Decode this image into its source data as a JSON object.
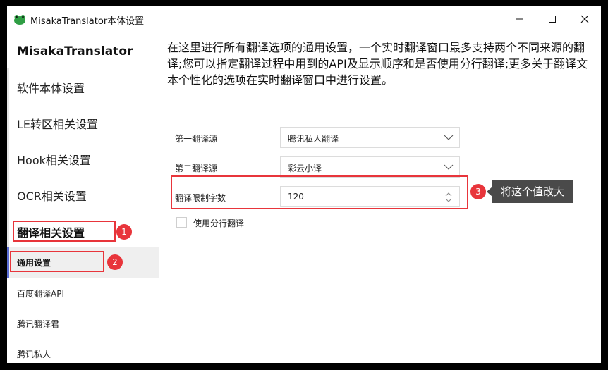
{
  "window": {
    "title": "MisakaTranslator本体设置"
  },
  "sidebar": {
    "app_name": "MisakaTranslator",
    "items": [
      {
        "label": "软件本体设置"
      },
      {
        "label": "LE转区相关设置"
      },
      {
        "label": "Hook相关设置"
      },
      {
        "label": "OCR相关设置"
      },
      {
        "label": "翻译相关设置"
      },
      {
        "label": "通用设置"
      },
      {
        "label": "百度翻译API"
      },
      {
        "label": "腾讯翻译君"
      },
      {
        "label": "腾讯私人"
      }
    ]
  },
  "main": {
    "description": "在这里进行所有翻译选项的通用设置，一个实时翻译窗口最多支持两个不同来源的翻译;您可以指定翻译过程中用到的API及显示顺序和是否使用分行翻译;更多关于翻译文本个性化的选项在实时翻译窗口中进行设置。",
    "first_source_label": "第一翻译源",
    "first_source_value": "腾讯私人翻译",
    "second_source_label": "第二翻译源",
    "second_source_value": "彩云小译",
    "limit_label": "翻译限制字数",
    "limit_value": "120",
    "split_label": "使用分行翻译"
  },
  "annotations": {
    "badge1": "1",
    "badge2": "2",
    "badge3": "3",
    "tooltip": "将这个值改大"
  },
  "colors": {
    "accent_red": "#e8353b",
    "selected_bg": "#efefef",
    "selected_bar": "#5b6fd6"
  }
}
